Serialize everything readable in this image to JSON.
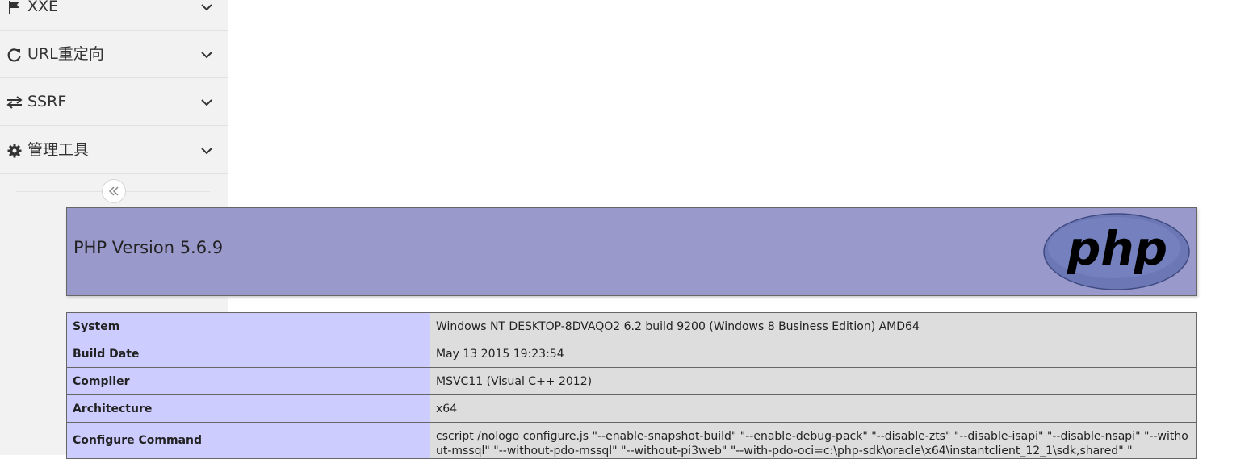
{
  "sidebar": {
    "items": [
      {
        "label": "XXE",
        "icon": "flag-icon"
      },
      {
        "label": "URL重定向",
        "icon": "refresh-icon"
      },
      {
        "label": "SSRF",
        "icon": "exchange-icon"
      },
      {
        "label": "管理工具",
        "icon": "gear-icon"
      }
    ],
    "collapse_icon": "double-chevron-left-icon"
  },
  "phpinfo": {
    "title": "PHP Version 5.6.9",
    "logo_text": "php",
    "rows": [
      {
        "key": "System",
        "value": "Windows NT DESKTOP-8DVAQO2 6.2 build 9200 (Windows 8 Business Edition) AMD64"
      },
      {
        "key": "Build Date",
        "value": "May 13 2015 19:23:54"
      },
      {
        "key": "Compiler",
        "value": "MSVC11 (Visual C++ 2012)"
      },
      {
        "key": "Architecture",
        "value": "x64"
      },
      {
        "key": "Configure Command",
        "value": "cscript /nologo configure.js \"--enable-snapshot-build\" \"--enable-debug-pack\" \"--disable-zts\" \"--disable-isapi\" \"--disable-nsapi\" \"--without-mssql\" \"--without-pdo-mssql\" \"--without-pi3web\" \"--with-pdo-oci=c:\\php-sdk\\oracle\\x64\\instantclient_12_1\\sdk,shared\" \""
      }
    ]
  },
  "colors": {
    "header_bg": "#9999cc",
    "key_cell_bg": "#ccccff",
    "value_cell_bg": "#dddddd",
    "sidebar_bg": "#f2f2f2",
    "logo_fill": "#6c78b6"
  }
}
